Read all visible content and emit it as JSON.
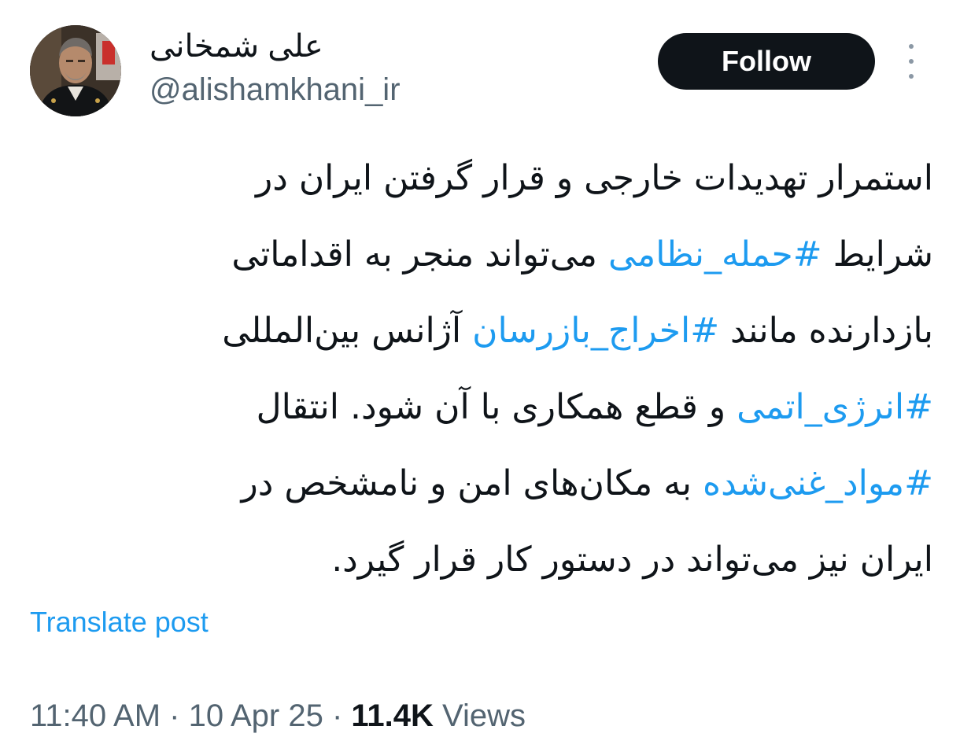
{
  "author": {
    "display_name": "علی شمخانی",
    "handle": "@alishamkhani_ir"
  },
  "actions": {
    "follow_label": "Follow",
    "more_icon": "more-vertical-icon"
  },
  "tweet": {
    "lines": [
      [
        {
          "text": "استمرار تهدیدات خارجی و قرار گرفتن ایران در"
        }
      ],
      [
        {
          "text": "شرایط "
        },
        {
          "text": "#حمله_نظامی",
          "hashtag": true
        },
        {
          "text": " می‌تواند منجر به اقداماتی"
        }
      ],
      [
        {
          "text": "بازدارنده مانند "
        },
        {
          "text": "#اخراج_بازرسان",
          "hashtag": true
        },
        {
          "text": " آژانس بین‌المللی"
        }
      ],
      [
        {
          "text": "#انرژی_اتمی",
          "hashtag": true
        },
        {
          "text": " و قطع همکاری با آن شود. انتقال"
        }
      ],
      [
        {
          "text": "#مواد_غنی‌شده",
          "hashtag": true
        },
        {
          "text": " به مکان‌های امن و نامشخص در"
        }
      ],
      [
        {
          "text": "ایران نیز می‌تواند در دستور کار قرار گیرد."
        }
      ]
    ]
  },
  "translate_label": "Translate post",
  "meta": {
    "time": "11:40 AM",
    "separator": " · ",
    "date": "10 Apr 25",
    "views_count": "11.4K",
    "views_label": " Views"
  },
  "colors": {
    "link": "#1d9bf0",
    "text": "#0f1419",
    "secondary": "#536471",
    "button_bg": "#0f1419"
  }
}
